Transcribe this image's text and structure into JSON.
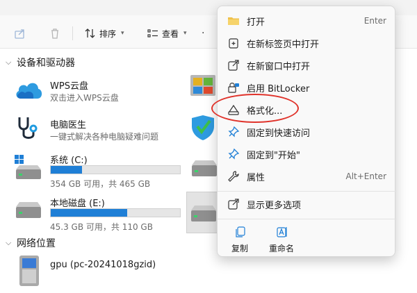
{
  "toolbar": {
    "sort_label": "排序",
    "view_label": "查看"
  },
  "groups": {
    "devices_label": "设备和驱动器",
    "network_label": "网络位置"
  },
  "drives": [
    {
      "name": "WPS云盘",
      "sub": "双击进入WPS云盘"
    },
    {
      "name": "电脑医生",
      "sub": "一键式解决各种电脑疑难问题"
    },
    {
      "name": "系统 (C:)",
      "sub": "354 GB 可用，共 465 GB",
      "used_fraction": 0.24
    },
    {
      "name": "本地磁盘 (E:)",
      "sub": "45.3 GB 可用，共 110 GB",
      "used_fraction": 0.59
    }
  ],
  "network": [
    {
      "name": "gpu (pc-20241018gzid)"
    }
  ],
  "context_menu": {
    "items": [
      {
        "label": "打开",
        "shortcut": "Enter",
        "icon": "folder-icon"
      },
      {
        "label": "在新标签页中打开",
        "icon": "new-tab-icon"
      },
      {
        "label": "在新窗口中打开",
        "icon": "new-window-icon"
      },
      {
        "label": "启用 BitLocker",
        "icon": "bitlocker-icon"
      },
      {
        "label": "格式化...",
        "icon": "format-icon"
      },
      {
        "label": "固定到快速访问",
        "icon": "pin-icon"
      },
      {
        "label": "固定到\"开始\"",
        "icon": "pin-start-icon"
      },
      {
        "label": "属性",
        "shortcut": "Alt+Enter",
        "icon": "wrench-icon"
      },
      {
        "label": "显示更多选项",
        "icon": "more-options-icon"
      }
    ],
    "quick_actions": [
      {
        "label": "复制",
        "icon": "copy-icon"
      },
      {
        "label": "重命名",
        "icon": "rename-icon"
      }
    ]
  },
  "colors": {
    "accent": "#1f7fd6",
    "highlight": "#e0332b"
  }
}
